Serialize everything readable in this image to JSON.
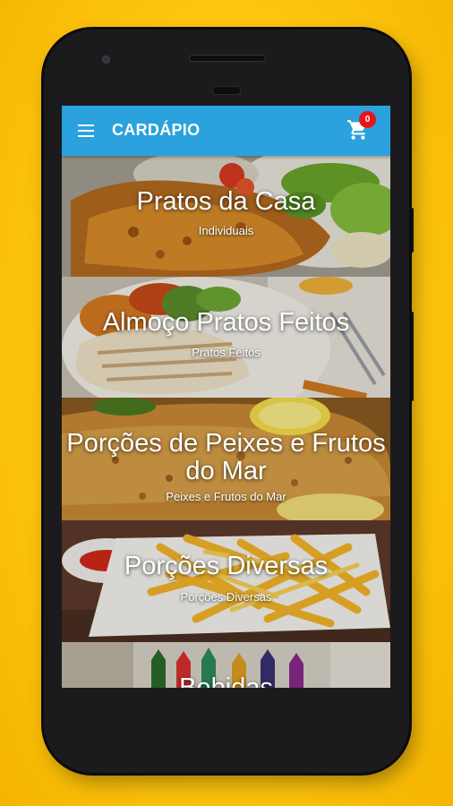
{
  "appbar": {
    "title": "CARDÁPIO",
    "menu_icon": "menu-icon",
    "cart_icon": "shopping-cart-icon",
    "cart_count": "0",
    "color": "#2ba1dd"
  },
  "categories": [
    {
      "title": "Pratos da Casa",
      "subtitle": "Individuais"
    },
    {
      "title": "Almoço Pratos Feitos",
      "subtitle": "Pratos Feitos"
    },
    {
      "title": "Porções de Peixes e Frutos do Mar",
      "subtitle": "Peixes e Frutos do Mar"
    },
    {
      "title": "Porções Diversas",
      "subtitle": "Porções Diversas"
    },
    {
      "title": "Bebidas",
      "subtitle": ""
    }
  ]
}
